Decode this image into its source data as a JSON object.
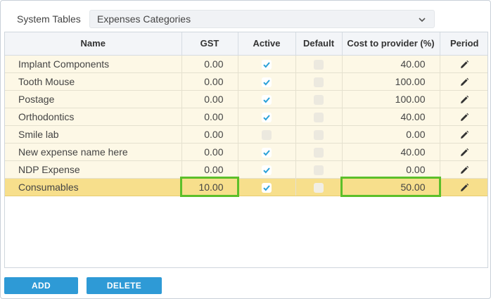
{
  "header": {
    "label": "System Tables",
    "selected_table": "Expenses Categories"
  },
  "columns": [
    "Name",
    "GST",
    "Active",
    "Default",
    "Cost to provider (%)",
    "Period"
  ],
  "rows": [
    {
      "name": "Implant Components",
      "gst": "0.00",
      "active": true,
      "default": false,
      "cost": "40.00",
      "selected": false
    },
    {
      "name": "Tooth Mouse",
      "gst": "0.00",
      "active": true,
      "default": false,
      "cost": "100.00",
      "selected": false
    },
    {
      "name": "Postage",
      "gst": "0.00",
      "active": true,
      "default": false,
      "cost": "100.00",
      "selected": false
    },
    {
      "name": "Orthodontics",
      "gst": "0.00",
      "active": true,
      "default": false,
      "cost": "40.00",
      "selected": false
    },
    {
      "name": "Smile lab",
      "gst": "0.00",
      "active": false,
      "default": false,
      "cost": "0.00",
      "selected": false
    },
    {
      "name": "New expense name here",
      "gst": "0.00",
      "active": true,
      "default": false,
      "cost": "40.00",
      "selected": false
    },
    {
      "name": "NDP Expense",
      "gst": "0.00",
      "active": true,
      "default": false,
      "cost": "0.00",
      "selected": false
    },
    {
      "name": "Consumables",
      "gst": "10.00",
      "active": true,
      "default": false,
      "cost": "50.00",
      "selected": true
    }
  ],
  "buttons": {
    "add": "ADD",
    "delete": "DELETE"
  },
  "colors": {
    "row_bg": "#fdf8e6",
    "selected_row_bg": "#f7df8c",
    "button_bg": "#2e9ad6",
    "check_color": "#2aa1d8",
    "highlight": "#5cbf2a"
  },
  "icons": {
    "select_chevron": "chevron-down-icon",
    "period": "pencil-icon",
    "check": "check-icon"
  }
}
